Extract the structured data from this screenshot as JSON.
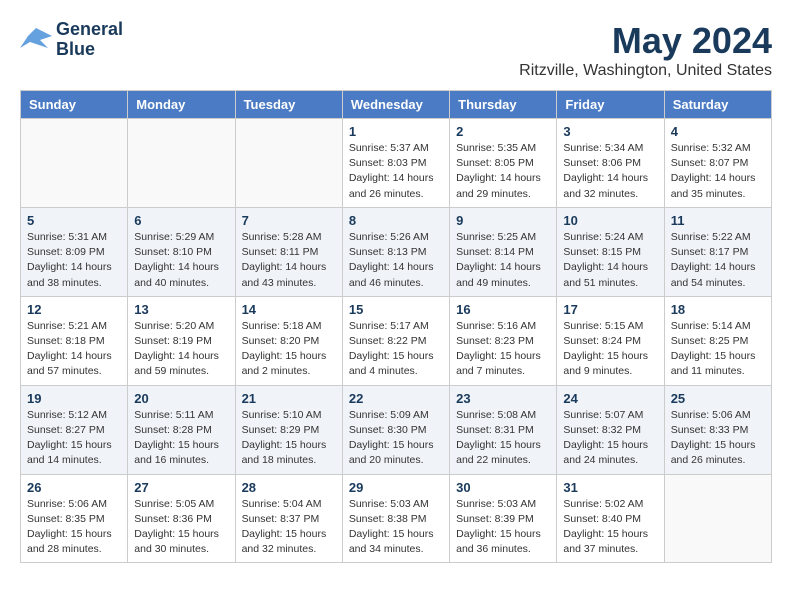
{
  "header": {
    "logo_line1": "General",
    "logo_line2": "Blue",
    "main_title": "May 2024",
    "subtitle": "Ritzville, Washington, United States"
  },
  "weekdays": [
    "Sunday",
    "Monday",
    "Tuesday",
    "Wednesday",
    "Thursday",
    "Friday",
    "Saturday"
  ],
  "weeks": [
    [
      {
        "day": "",
        "info": ""
      },
      {
        "day": "",
        "info": ""
      },
      {
        "day": "",
        "info": ""
      },
      {
        "day": "1",
        "info": "Sunrise: 5:37 AM\nSunset: 8:03 PM\nDaylight: 14 hours\nand 26 minutes."
      },
      {
        "day": "2",
        "info": "Sunrise: 5:35 AM\nSunset: 8:05 PM\nDaylight: 14 hours\nand 29 minutes."
      },
      {
        "day": "3",
        "info": "Sunrise: 5:34 AM\nSunset: 8:06 PM\nDaylight: 14 hours\nand 32 minutes."
      },
      {
        "day": "4",
        "info": "Sunrise: 5:32 AM\nSunset: 8:07 PM\nDaylight: 14 hours\nand 35 minutes."
      }
    ],
    [
      {
        "day": "5",
        "info": "Sunrise: 5:31 AM\nSunset: 8:09 PM\nDaylight: 14 hours\nand 38 minutes."
      },
      {
        "day": "6",
        "info": "Sunrise: 5:29 AM\nSunset: 8:10 PM\nDaylight: 14 hours\nand 40 minutes."
      },
      {
        "day": "7",
        "info": "Sunrise: 5:28 AM\nSunset: 8:11 PM\nDaylight: 14 hours\nand 43 minutes."
      },
      {
        "day": "8",
        "info": "Sunrise: 5:26 AM\nSunset: 8:13 PM\nDaylight: 14 hours\nand 46 minutes."
      },
      {
        "day": "9",
        "info": "Sunrise: 5:25 AM\nSunset: 8:14 PM\nDaylight: 14 hours\nand 49 minutes."
      },
      {
        "day": "10",
        "info": "Sunrise: 5:24 AM\nSunset: 8:15 PM\nDaylight: 14 hours\nand 51 minutes."
      },
      {
        "day": "11",
        "info": "Sunrise: 5:22 AM\nSunset: 8:17 PM\nDaylight: 14 hours\nand 54 minutes."
      }
    ],
    [
      {
        "day": "12",
        "info": "Sunrise: 5:21 AM\nSunset: 8:18 PM\nDaylight: 14 hours\nand 57 minutes."
      },
      {
        "day": "13",
        "info": "Sunrise: 5:20 AM\nSunset: 8:19 PM\nDaylight: 14 hours\nand 59 minutes."
      },
      {
        "day": "14",
        "info": "Sunrise: 5:18 AM\nSunset: 8:20 PM\nDaylight: 15 hours\nand 2 minutes."
      },
      {
        "day": "15",
        "info": "Sunrise: 5:17 AM\nSunset: 8:22 PM\nDaylight: 15 hours\nand 4 minutes."
      },
      {
        "day": "16",
        "info": "Sunrise: 5:16 AM\nSunset: 8:23 PM\nDaylight: 15 hours\nand 7 minutes."
      },
      {
        "day": "17",
        "info": "Sunrise: 5:15 AM\nSunset: 8:24 PM\nDaylight: 15 hours\nand 9 minutes."
      },
      {
        "day": "18",
        "info": "Sunrise: 5:14 AM\nSunset: 8:25 PM\nDaylight: 15 hours\nand 11 minutes."
      }
    ],
    [
      {
        "day": "19",
        "info": "Sunrise: 5:12 AM\nSunset: 8:27 PM\nDaylight: 15 hours\nand 14 minutes."
      },
      {
        "day": "20",
        "info": "Sunrise: 5:11 AM\nSunset: 8:28 PM\nDaylight: 15 hours\nand 16 minutes."
      },
      {
        "day": "21",
        "info": "Sunrise: 5:10 AM\nSunset: 8:29 PM\nDaylight: 15 hours\nand 18 minutes."
      },
      {
        "day": "22",
        "info": "Sunrise: 5:09 AM\nSunset: 8:30 PM\nDaylight: 15 hours\nand 20 minutes."
      },
      {
        "day": "23",
        "info": "Sunrise: 5:08 AM\nSunset: 8:31 PM\nDaylight: 15 hours\nand 22 minutes."
      },
      {
        "day": "24",
        "info": "Sunrise: 5:07 AM\nSunset: 8:32 PM\nDaylight: 15 hours\nand 24 minutes."
      },
      {
        "day": "25",
        "info": "Sunrise: 5:06 AM\nSunset: 8:33 PM\nDaylight: 15 hours\nand 26 minutes."
      }
    ],
    [
      {
        "day": "26",
        "info": "Sunrise: 5:06 AM\nSunset: 8:35 PM\nDaylight: 15 hours\nand 28 minutes."
      },
      {
        "day": "27",
        "info": "Sunrise: 5:05 AM\nSunset: 8:36 PM\nDaylight: 15 hours\nand 30 minutes."
      },
      {
        "day": "28",
        "info": "Sunrise: 5:04 AM\nSunset: 8:37 PM\nDaylight: 15 hours\nand 32 minutes."
      },
      {
        "day": "29",
        "info": "Sunrise: 5:03 AM\nSunset: 8:38 PM\nDaylight: 15 hours\nand 34 minutes."
      },
      {
        "day": "30",
        "info": "Sunrise: 5:03 AM\nSunset: 8:39 PM\nDaylight: 15 hours\nand 36 minutes."
      },
      {
        "day": "31",
        "info": "Sunrise: 5:02 AM\nSunset: 8:40 PM\nDaylight: 15 hours\nand 37 minutes."
      },
      {
        "day": "",
        "info": ""
      }
    ]
  ]
}
